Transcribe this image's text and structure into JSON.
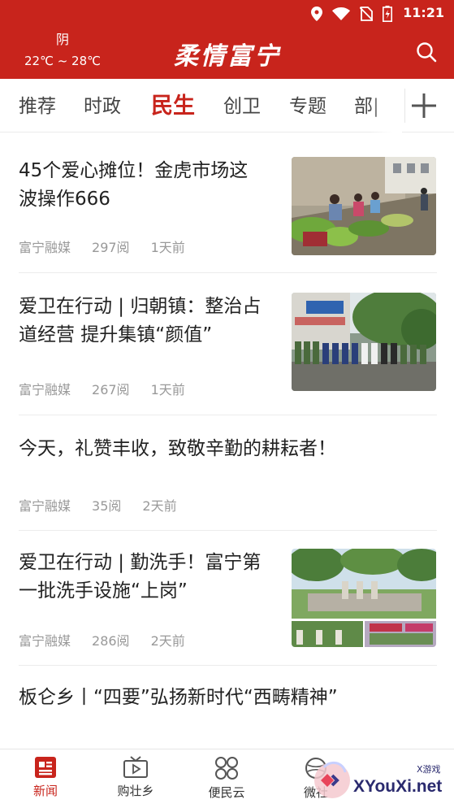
{
  "status_bar": {
    "time": "11:21"
  },
  "header": {
    "weather_condition": "阴",
    "weather_temp": "22℃ ~ 28℃",
    "app_title": "柔情富宁"
  },
  "tabs": [
    {
      "label": "推荐",
      "active": false
    },
    {
      "label": "时政",
      "active": false
    },
    {
      "label": "民生",
      "active": true
    },
    {
      "label": "创卫",
      "active": false
    },
    {
      "label": "专题",
      "active": false
    },
    {
      "label": "部|",
      "active": false
    }
  ],
  "news": [
    {
      "title": "45个爱心摊位！金虎市场这波操作666",
      "source": "富宁融媒",
      "reads": "297阅",
      "time": "1天前"
    },
    {
      "title": "爱卫在行动 | 归朝镇：整治占道经营 提升集镇“颜值”",
      "source": "富宁融媒",
      "reads": "267阅",
      "time": "1天前"
    },
    {
      "title": "今天，礼赞丰收，致敬辛勤的耕耘者！",
      "source": "富宁融媒",
      "reads": "35阅",
      "time": "2天前"
    },
    {
      "title": "爱卫在行动 | 勤洗手！富宁第一批洗手设施“上岗”",
      "source": "富宁融媒",
      "reads": "286阅",
      "time": "2天前"
    },
    {
      "title": "板仑乡丨“四要”弘扬新时代“西畴精神”"
    }
  ],
  "bottom_nav": [
    {
      "label": "新闻",
      "active": true
    },
    {
      "label": "购壮乡",
      "active": false
    },
    {
      "label": "便民云",
      "active": false
    },
    {
      "label": "微社",
      "active": false
    }
  ],
  "watermark": {
    "text": "XYouXi.net",
    "small": "X游戏"
  },
  "colors": {
    "brand_red": "#c8241c",
    "meta_gray": "#999999",
    "text_dark": "#222222"
  }
}
